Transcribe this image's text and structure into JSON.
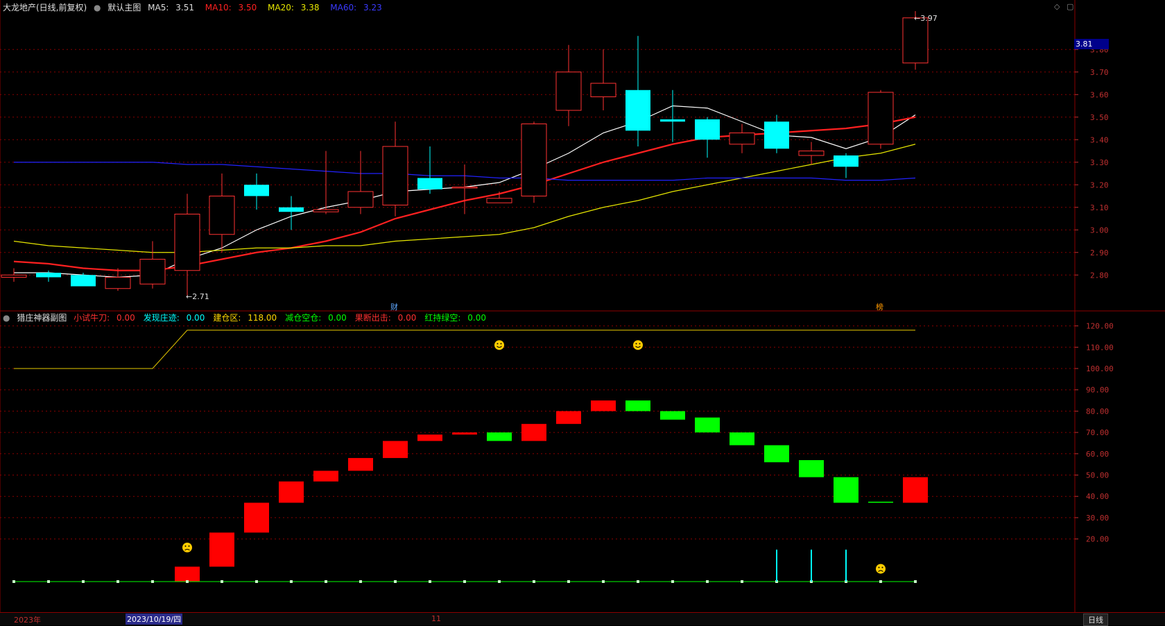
{
  "main_header": {
    "title": "大龙地产(日线,前复权)",
    "template": "默认主图",
    "ma5_label": "MA5:",
    "ma5_value": "3.51",
    "ma10_label": "MA10:",
    "ma10_value": "3.50",
    "ma20_label": "MA20:",
    "ma20_value": "3.38",
    "ma60_label": "MA60:",
    "ma60_value": "3.23"
  },
  "sub_header": {
    "title": "猎庄神器副图",
    "items": [
      {
        "label": "小试牛刀:",
        "value": "0.00",
        "color": "#ff3030"
      },
      {
        "label": "发现庄迹:",
        "value": "0.00",
        "color": "#00ffff"
      },
      {
        "label": "建仓区:",
        "value": "118.00",
        "color": "#ffd700"
      },
      {
        "label": "减仓空仓:",
        "value": "0.00",
        "color": "#00ff00"
      },
      {
        "label": "果断出击:",
        "value": "0.00",
        "color": "#ff3030"
      },
      {
        "label": "红持绿空:",
        "value": "0.00",
        "color": "#00ff00"
      }
    ]
  },
  "price_marker": "3.81",
  "high_label": "3.97",
  "low_label": "2.71",
  "event_marks": [
    "财",
    "榜"
  ],
  "bottom_bar": {
    "year": "2023年",
    "cursor_date": "2023/10/19/四",
    "month": "11",
    "period": "日线"
  },
  "colors": {
    "up": "#ff3232",
    "down": "#00ffff",
    "ma5": "#ffffff",
    "ma10": "#ff2020",
    "ma20": "#e6e600",
    "ma60": "#2222ff",
    "grid": "#8b0000"
  },
  "chart_data": [
    {
      "type": "candlestick",
      "title": "大龙地产(日线,前复权)",
      "ylim": [
        2.71,
        3.97
      ],
      "y_ticks": [
        2.8,
        2.9,
        3.0,
        3.1,
        3.2,
        3.3,
        3.4,
        3.5,
        3.6,
        3.7,
        3.8
      ],
      "candles": [
        {
          "o": 2.79,
          "h": 2.83,
          "l": 2.77,
          "c": 2.8
        },
        {
          "o": 2.81,
          "h": 2.82,
          "l": 2.77,
          "c": 2.79
        },
        {
          "o": 2.8,
          "h": 2.81,
          "l": 2.75,
          "c": 2.75
        },
        {
          "o": 2.74,
          "h": 2.83,
          "l": 2.73,
          "c": 2.79
        },
        {
          "o": 2.76,
          "h": 2.95,
          "l": 2.74,
          "c": 2.87
        },
        {
          "o": 2.82,
          "h": 3.16,
          "l": 2.71,
          "c": 3.07
        },
        {
          "o": 2.98,
          "h": 3.25,
          "l": 2.9,
          "c": 3.15
        },
        {
          "o": 3.2,
          "h": 3.25,
          "l": 3.09,
          "c": 3.15
        },
        {
          "o": 3.1,
          "h": 3.15,
          "l": 3.0,
          "c": 3.08
        },
        {
          "o": 3.08,
          "h": 3.35,
          "l": 3.07,
          "c": 3.09
        },
        {
          "o": 3.1,
          "h": 3.35,
          "l": 3.07,
          "c": 3.17
        },
        {
          "o": 3.11,
          "h": 3.48,
          "l": 3.06,
          "c": 3.37
        },
        {
          "o": 3.23,
          "h": 3.37,
          "l": 3.16,
          "c": 3.18
        },
        {
          "o": 3.19,
          "h": 3.29,
          "l": 3.07,
          "c": 3.19
        },
        {
          "o": 3.12,
          "h": 3.17,
          "l": 3.12,
          "c": 3.14
        },
        {
          "o": 3.15,
          "h": 3.48,
          "l": 3.12,
          "c": 3.47
        },
        {
          "o": 3.53,
          "h": 3.82,
          "l": 3.46,
          "c": 3.7
        },
        {
          "o": 3.59,
          "h": 3.8,
          "l": 3.53,
          "c": 3.65
        },
        {
          "o": 3.62,
          "h": 3.86,
          "l": 3.37,
          "c": 3.44
        },
        {
          "o": 3.49,
          "h": 3.62,
          "l": 3.39,
          "c": 3.48
        },
        {
          "o": 3.49,
          "h": 3.5,
          "l": 3.32,
          "c": 3.4
        },
        {
          "o": 3.38,
          "h": 3.47,
          "l": 3.34,
          "c": 3.43
        },
        {
          "o": 3.48,
          "h": 3.51,
          "l": 3.34,
          "c": 3.36
        },
        {
          "o": 3.33,
          "h": 3.39,
          "l": 3.29,
          "c": 3.35
        },
        {
          "o": 3.33,
          "h": 3.34,
          "l": 3.23,
          "c": 3.28
        },
        {
          "o": 3.38,
          "h": 3.62,
          "l": 3.36,
          "c": 3.61
        },
        {
          "o": 3.74,
          "h": 3.97,
          "l": 3.71,
          "c": 3.94
        }
      ],
      "series": [
        {
          "name": "MA5",
          "values": [
            2.81,
            2.81,
            2.8,
            2.79,
            2.8,
            2.87,
            2.92,
            3.0,
            3.06,
            3.1,
            3.13,
            3.17,
            3.18,
            3.19,
            3.21,
            3.27,
            3.34,
            3.43,
            3.48,
            3.55,
            3.54,
            3.48,
            3.42,
            3.41,
            3.36,
            3.41,
            3.51
          ]
        },
        {
          "name": "MA10",
          "values": [
            2.86,
            2.85,
            2.83,
            2.82,
            2.82,
            2.84,
            2.87,
            2.9,
            2.92,
            2.95,
            2.99,
            3.05,
            3.09,
            3.13,
            3.16,
            3.2,
            3.25,
            3.3,
            3.34,
            3.38,
            3.41,
            3.42,
            3.43,
            3.44,
            3.45,
            3.47,
            3.5
          ]
        },
        {
          "name": "MA20",
          "values": [
            2.95,
            2.93,
            2.92,
            2.91,
            2.9,
            2.9,
            2.91,
            2.92,
            2.92,
            2.93,
            2.93,
            2.95,
            2.96,
            2.97,
            2.98,
            3.01,
            3.06,
            3.1,
            3.13,
            3.17,
            3.2,
            3.23,
            3.26,
            3.29,
            3.32,
            3.34,
            3.38
          ]
        },
        {
          "name": "MA60",
          "values": [
            3.3,
            3.3,
            3.3,
            3.3,
            3.3,
            3.29,
            3.29,
            3.28,
            3.27,
            3.26,
            3.25,
            3.25,
            3.24,
            3.24,
            3.23,
            3.23,
            3.22,
            3.22,
            3.22,
            3.22,
            3.23,
            3.23,
            3.23,
            3.23,
            3.22,
            3.22,
            3.23
          ]
        }
      ]
    },
    {
      "type": "indicator",
      "title": "猎庄神器副图",
      "ylim": [
        0,
        125
      ],
      "y_ticks": [
        20,
        30,
        40,
        50,
        60,
        70,
        80,
        90,
        100,
        110,
        120
      ],
      "bars": [
        null,
        null,
        null,
        null,
        null,
        {
          "lo": 0,
          "hi": 7,
          "c": "red"
        },
        {
          "lo": 7,
          "hi": 23,
          "c": "red"
        },
        {
          "lo": 23,
          "hi": 37,
          "c": "red"
        },
        {
          "lo": 37,
          "hi": 47,
          "c": "red"
        },
        {
          "lo": 47,
          "hi": 52,
          "c": "red"
        },
        {
          "lo": 52,
          "hi": 58,
          "c": "red"
        },
        {
          "lo": 58,
          "hi": 66,
          "c": "red"
        },
        {
          "lo": 66,
          "hi": 69,
          "c": "red"
        },
        {
          "lo": 69,
          "hi": 70,
          "c": "red"
        },
        {
          "lo": 66,
          "hi": 70,
          "c": "green"
        },
        {
          "lo": 66,
          "hi": 74,
          "c": "red"
        },
        {
          "lo": 74,
          "hi": 80,
          "c": "red"
        },
        {
          "lo": 80,
          "hi": 85,
          "c": "red"
        },
        {
          "lo": 80,
          "hi": 85,
          "c": "green"
        },
        {
          "lo": 76,
          "hi": 80,
          "c": "green"
        },
        {
          "lo": 70,
          "hi": 77,
          "c": "green"
        },
        {
          "lo": 64,
          "hi": 70,
          "c": "green"
        },
        {
          "lo": 56,
          "hi": 64,
          "c": "green"
        },
        {
          "lo": 49,
          "hi": 57,
          "c": "green"
        },
        {
          "lo": 37,
          "hi": 49,
          "c": "green"
        },
        {
          "lo": 37,
          "hi": 37.5,
          "c": "green"
        },
        {
          "lo": 37,
          "hi": 49,
          "c": "red"
        }
      ],
      "line_yellow": [
        100,
        100,
        100,
        100,
        100,
        118,
        118,
        118,
        118,
        118,
        118,
        118,
        118,
        118,
        118,
        118,
        118,
        118,
        118,
        118,
        118,
        118,
        118,
        118,
        118,
        118,
        118
      ],
      "cyan_spikes": [
        {
          "i": 22,
          "v": 15
        },
        {
          "i": 23,
          "v": 15
        },
        {
          "i": 24,
          "v": 15
        }
      ],
      "smileys": [
        {
          "i": 14,
          "v": 111,
          "face": "happy"
        },
        {
          "i": 18,
          "v": 111,
          "face": "happy"
        },
        {
          "i": 5,
          "v": 16,
          "face": "sad"
        },
        {
          "i": 25,
          "v": 6,
          "face": "sad"
        }
      ]
    }
  ]
}
